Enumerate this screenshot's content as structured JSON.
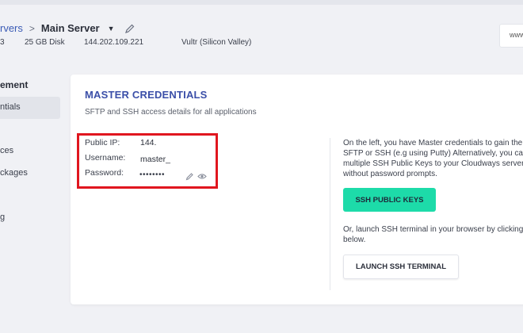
{
  "breadcrumb": {
    "parent": "rvers",
    "separator": ">",
    "current": "Main Server"
  },
  "server_specs": {
    "partial": "3",
    "disk": "25 GB Disk",
    "ip": "144.202.109.221",
    "provider": "Vultr (Silicon Valley)"
  },
  "url_box": {
    "text": "www"
  },
  "sidebar": {
    "heading": "ement",
    "items": [
      {
        "label": "ntials",
        "active": true
      },
      {
        "label": "ces",
        "active": false
      },
      {
        "label": "ckages",
        "active": false
      },
      {
        "label": "g",
        "active": false
      }
    ]
  },
  "card": {
    "title": "MASTER CREDENTIALS",
    "subtitle": "SFTP and SSH access details for all applications",
    "credentials": {
      "public_ip_label": "Public IP:",
      "public_ip_value": "144.",
      "username_label": "Username:",
      "username_value": "master_",
      "password_label": "Password:",
      "password_value": "••••••••"
    },
    "info_lines": [
      "On the left, you have Master credentials to gain the",
      "SFTP or SSH (e.g using Putty) Alternatively, you can",
      "multiple SSH Public Keys to your Cloudways server",
      "without password prompts."
    ],
    "ssh_keys_button": "SSH PUBLIC KEYS",
    "launch_info_lines": [
      "Or, launch SSH terminal in your browser by clicking",
      "below."
    ],
    "launch_button": "LAUNCH SSH TERMINAL"
  },
  "colors": {
    "accent_blue": "#3b4fa8",
    "primary_button": "#1ddba9",
    "highlight_border": "#e0161f"
  }
}
